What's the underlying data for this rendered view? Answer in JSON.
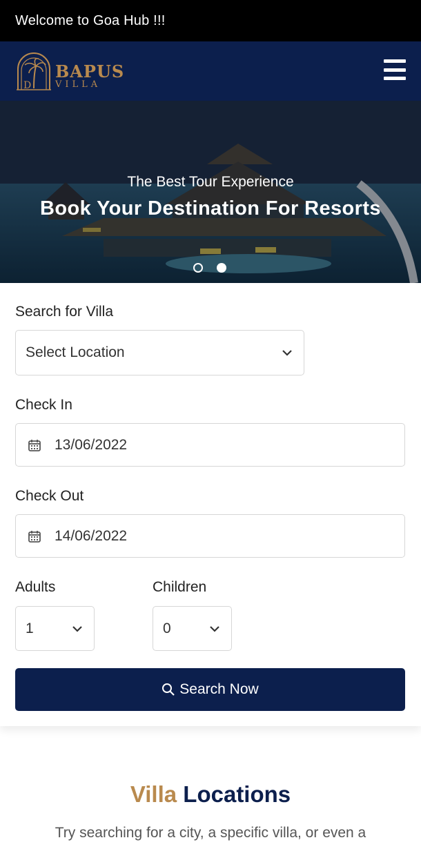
{
  "topbar": {
    "welcome_text": "Welcome to Goa Hub !!!"
  },
  "navbar": {
    "logo_name": "BAPUS",
    "logo_sub": "VILLA",
    "menu_icon": "hamburger-icon"
  },
  "hero": {
    "tagline": "The Best Tour Experience",
    "headline": "Book Your Destination For Resorts",
    "slides_count": 2,
    "active_slide": 2
  },
  "search_form": {
    "search_label": "Search for Villa",
    "location_value": "Select Location",
    "checkin_label": "Check In",
    "checkin_value": "13/06/2022",
    "checkout_label": "Check Out",
    "checkout_value": "14/06/2022",
    "adults_label": "Adults",
    "adults_value": "1",
    "children_label": "Children",
    "children_value": "0",
    "search_button": "Search Now"
  },
  "villa_locations": {
    "title_accent": "Villa",
    "title_rest": "Locations",
    "subtitle": "Try searching for a city, a specific villa, or even a"
  },
  "colors": {
    "navy": "#0c1f4d",
    "gold": "#b98a4e",
    "topbar": "#000000"
  }
}
